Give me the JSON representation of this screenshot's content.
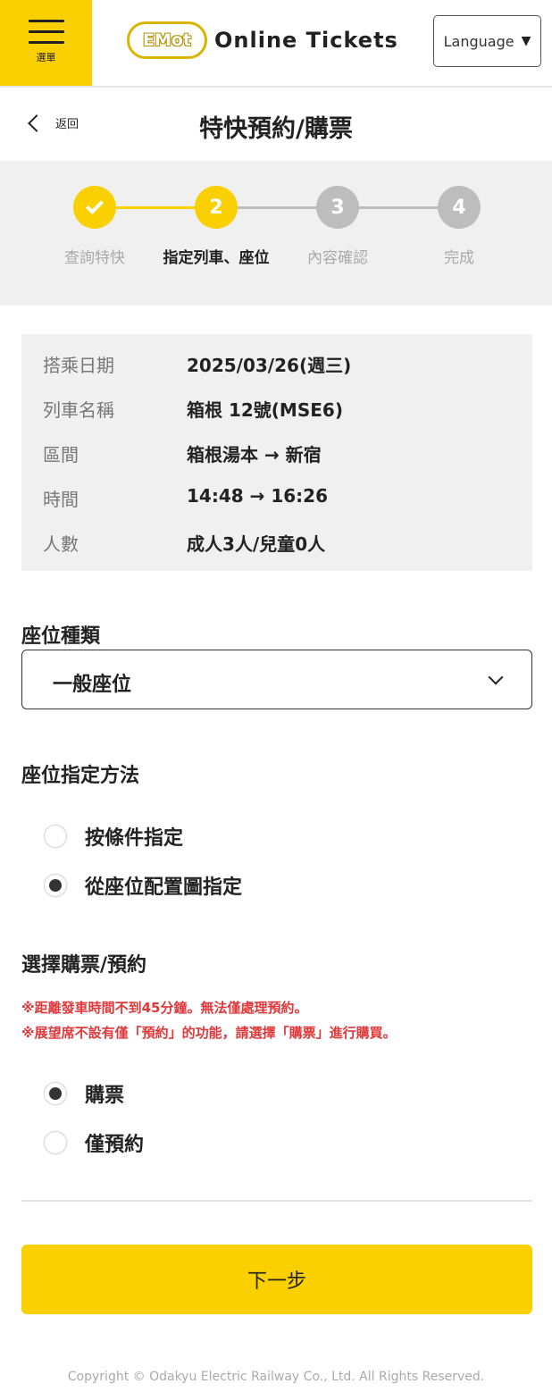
{
  "header": {
    "menu_label": "選單",
    "logo_badge": "EMot",
    "logo_text": "Online Tickets",
    "language_label": "Language",
    "language_caret": "▼"
  },
  "titlebar": {
    "back_label": "返回",
    "title": "特快預約/購票"
  },
  "stepper": {
    "steps": [
      {
        "number": "1",
        "label": "查詢特快",
        "state": "done"
      },
      {
        "number": "2",
        "label": "指定列車、座位",
        "state": "current"
      },
      {
        "number": "3",
        "label": "內容確認",
        "state": "pending"
      },
      {
        "number": "4",
        "label": "完成",
        "state": "pending"
      }
    ]
  },
  "info": {
    "rows": [
      {
        "key": "搭乘日期",
        "value": "2025/03/26(週三)"
      },
      {
        "key": "列車名稱",
        "value": "箱根 12號(MSE6)"
      },
      {
        "key": "區間",
        "value": "箱根湯本 → 新宿"
      },
      {
        "key": "時間",
        "value": "14:48 → 16:26"
      },
      {
        "key": "人數",
        "value": "成人3人/兒童0人"
      }
    ]
  },
  "seat_type": {
    "title": "座位種類",
    "selected": "一般座位"
  },
  "seat_method": {
    "title": "座位指定方法",
    "options": [
      {
        "label": "按條件指定",
        "checked": false
      },
      {
        "label": "從座位配置圖指定",
        "checked": true
      }
    ]
  },
  "purchase": {
    "title": "選擇購票/預約",
    "notices": [
      "※距離發車時間不到45分鐘。無法僅處理預約。",
      "※展望席不設有僅「預約」的功能，請選擇「購票」進行購買。"
    ],
    "options": [
      {
        "label": "購票",
        "checked": true
      },
      {
        "label": "僅預約",
        "checked": false
      }
    ]
  },
  "next_label": "下一步",
  "footer": "Copyright © Odakyu Electric Railway Co., Ltd. All Rights Reserved.",
  "colors": {
    "brand_yellow": "#fad000",
    "pending_gray": "#bdbdbd",
    "notice_red": "#e0383a"
  }
}
